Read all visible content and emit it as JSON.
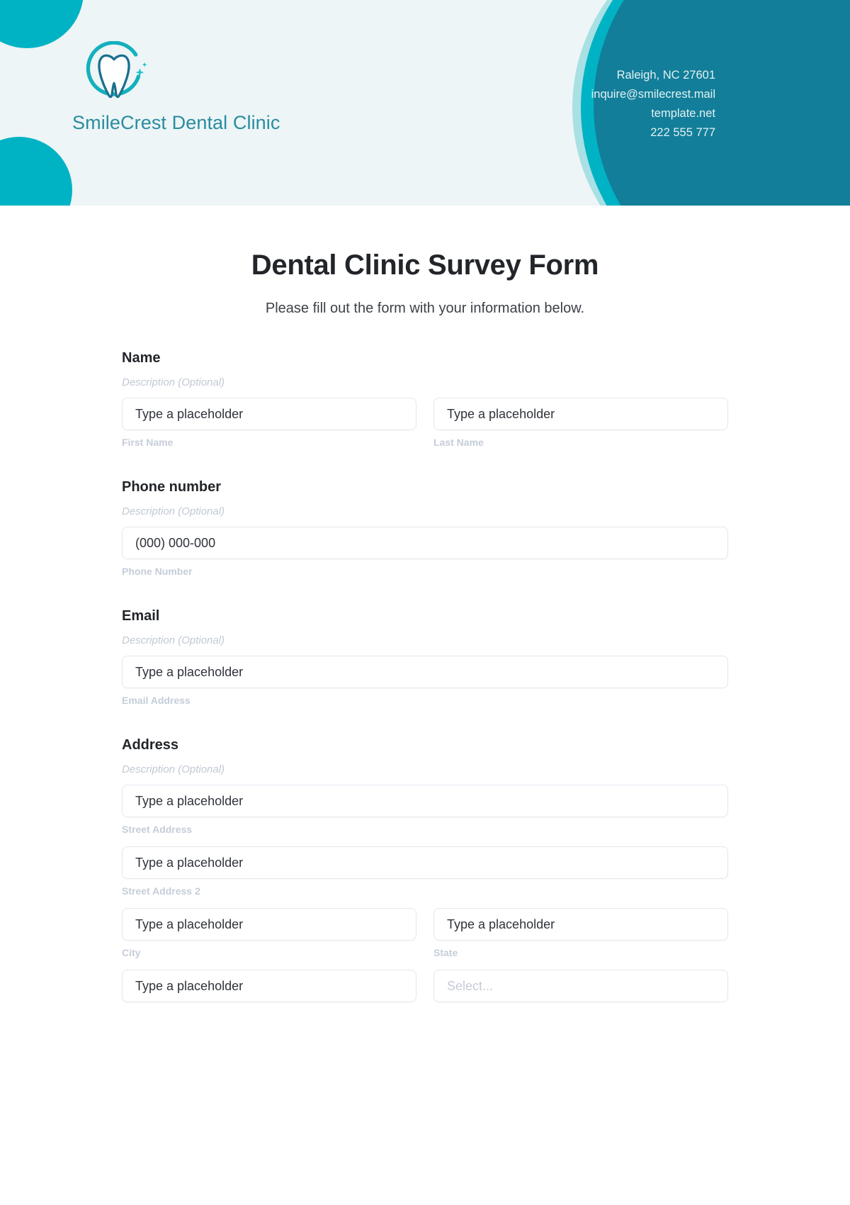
{
  "brand": {
    "name": "SmileCrest Dental Clinic",
    "logo_icon": "tooth-in-circle-icon"
  },
  "contact": {
    "address": "Raleigh, NC 27601",
    "email": "inquire@smilecrest.mail",
    "website": "template.net",
    "phone": "222 555 777"
  },
  "form": {
    "title": "Dental Clinic Survey Form",
    "subtitle": "Please fill out the form with your information below.",
    "description_optional": "Description (Optional)",
    "placeholder_default": "Type a placeholder",
    "placeholder_select": "Select...",
    "placeholder_phone": "(000) 000-000",
    "sections": {
      "name": {
        "label": "Name",
        "description": "Description (Optional)",
        "first_value": "Type a placeholder",
        "first_sub": "First Name",
        "last_value": "Type a placeholder",
        "last_sub": "Last Name"
      },
      "phone": {
        "label": "Phone number",
        "description": "Description (Optional)",
        "value": "(000) 000-000",
        "sub": "Phone Number"
      },
      "email": {
        "label": "Email",
        "description": "Description (Optional)",
        "value": "Type a placeholder",
        "sub": "Email Address"
      },
      "address": {
        "label": "Address",
        "description": "Description (Optional)",
        "street_value": "Type a placeholder",
        "street_sub": "Street Address",
        "street2_value": "Type a placeholder",
        "street2_sub": "Street Address 2",
        "city_value": "Type a placeholder",
        "city_sub": "City",
        "state_value": "Type a placeholder",
        "state_sub": "State",
        "zip_value": "Type a placeholder",
        "country_value": "Select..."
      }
    }
  },
  "colors": {
    "header_bg": "#edf5f6",
    "teal_bright": "#00b3c4",
    "teal_light": "#a8e0e4",
    "teal_dark": "#137e99",
    "brand_text": "#2a8ca0",
    "input_border": "#e3e7ee",
    "sub_label": "#c5cdd9"
  }
}
